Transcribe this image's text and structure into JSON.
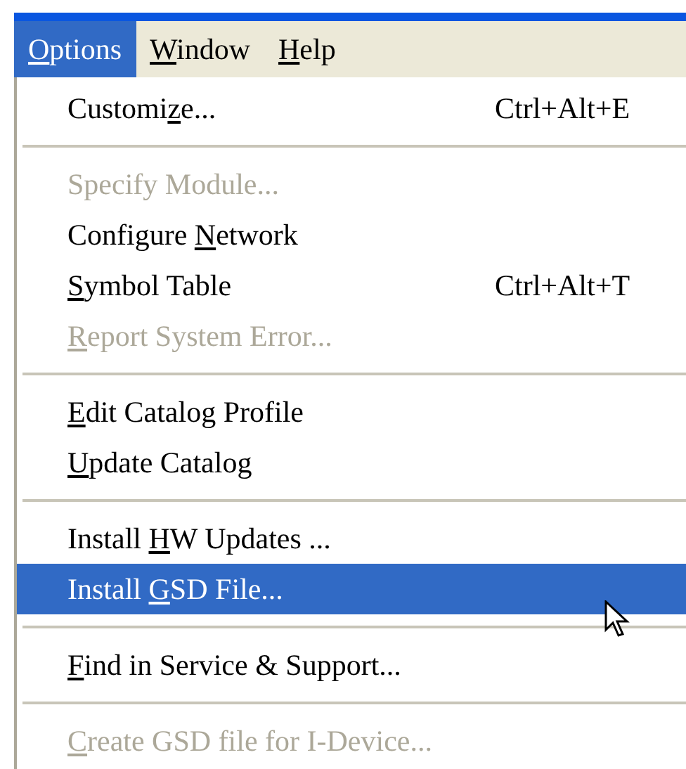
{
  "menubar": [
    {
      "key": "O",
      "post": "ptions",
      "selected": true
    },
    {
      "key": "W",
      "post": "indow",
      "selected": false
    },
    {
      "key": "H",
      "post": "elp",
      "selected": false
    }
  ],
  "menu": [
    {
      "kind": "item",
      "pre": "Customi",
      "key": "z",
      "post": "e...",
      "shortcut": "Ctrl+Alt+E",
      "disabled": false,
      "selected": false
    },
    {
      "kind": "separator"
    },
    {
      "kind": "item",
      "pre": "Specify Module...",
      "disabled": true,
      "selected": false
    },
    {
      "kind": "item",
      "pre": "Configure ",
      "key": "N",
      "post": "etwork",
      "disabled": false,
      "selected": false
    },
    {
      "kind": "item",
      "key": "S",
      "post": "ymbol Table",
      "shortcut": "Ctrl+Alt+T",
      "disabled": false,
      "selected": false
    },
    {
      "kind": "item",
      "key": "R",
      "post": "eport System Error...",
      "disabled": true,
      "selected": false
    },
    {
      "kind": "separator"
    },
    {
      "kind": "item",
      "key": "E",
      "post": "dit Catalog Profile",
      "disabled": false,
      "selected": false
    },
    {
      "kind": "item",
      "key": "U",
      "post": "pdate Catalog",
      "disabled": false,
      "selected": false
    },
    {
      "kind": "separator"
    },
    {
      "kind": "item",
      "pre": "Install ",
      "key": "H",
      "post": "W Updates ...",
      "disabled": false,
      "selected": false
    },
    {
      "kind": "item",
      "pre": "Install ",
      "key": "G",
      "post": "SD File...",
      "disabled": false,
      "selected": true
    },
    {
      "kind": "separator"
    },
    {
      "kind": "item",
      "key": "F",
      "post": "ind in Service & Support...",
      "disabled": false,
      "selected": false
    },
    {
      "kind": "separator"
    },
    {
      "kind": "item",
      "key": "C",
      "post": "reate GSD file for I-Device...",
      "disabled": true,
      "selected": false
    }
  ]
}
